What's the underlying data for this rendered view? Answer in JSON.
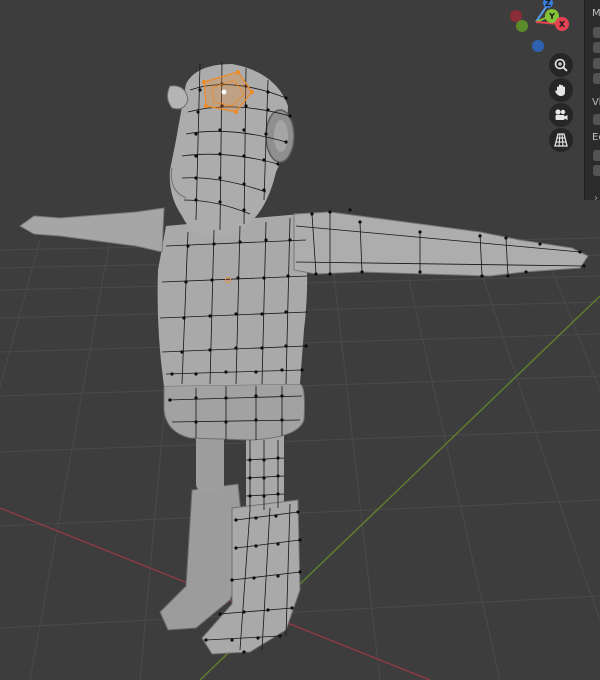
{
  "gizmo": {
    "x_label": "X",
    "y_label": "Y",
    "z_label": "Z",
    "x_color": "#e64352",
    "y_color": "#84c238",
    "z_color": "#3a7ee0"
  },
  "nav_buttons": [
    {
      "name": "zoom-icon"
    },
    {
      "name": "hand-pan-icon"
    },
    {
      "name": "camera-view-icon"
    },
    {
      "name": "ortho-grid-icon"
    }
  ],
  "sidebar": {
    "labels": [
      "M",
      "Vi",
      "Ec"
    ],
    "toggle_icon": "chevron-right-icon"
  },
  "colors": {
    "viewport_bg": "#3d3d3d",
    "grid_line": "#4a4a4a",
    "mesh_fill": "#a7a7a7",
    "mesh_shadow": "#8a8a8a",
    "wire": "#151515",
    "selected": "#f08a24"
  }
}
